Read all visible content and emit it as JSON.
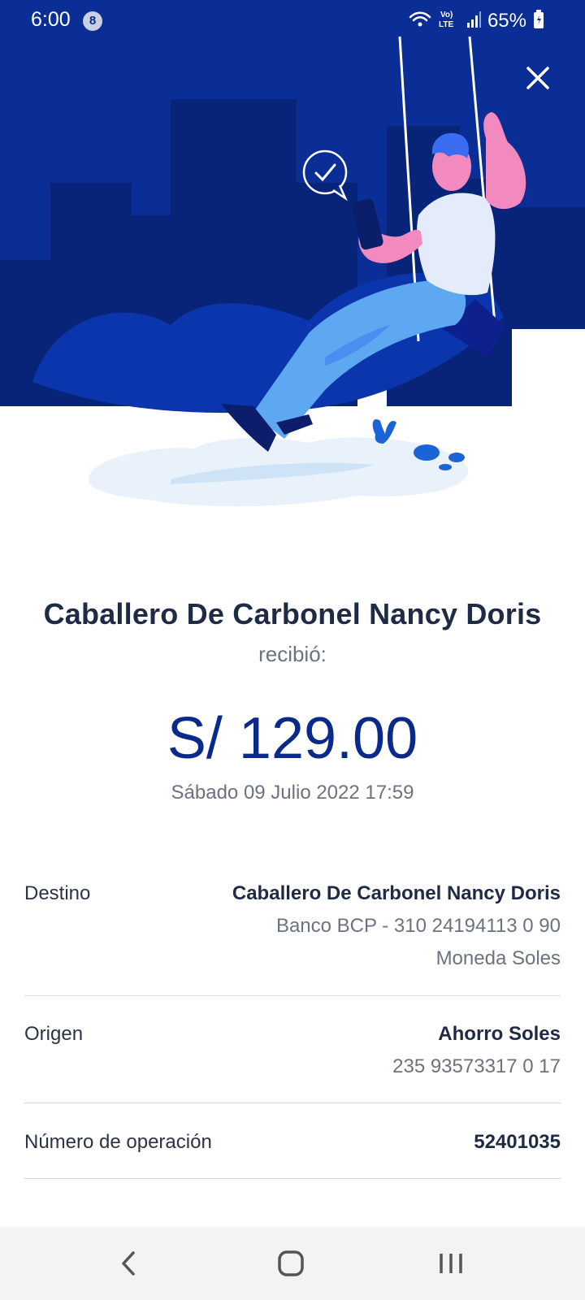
{
  "status_bar": {
    "time": "6:00",
    "notification_count": "8",
    "network": "LTE",
    "battery": "65%"
  },
  "receipt": {
    "recipient": "Caballero De Carbonel Nancy Doris",
    "received_label": "recibió:",
    "amount": "S/ 129.00",
    "date": "Sábado 09 Julio 2022 17:59"
  },
  "details": {
    "destino": {
      "label": "Destino",
      "name": "Caballero De Carbonel Nancy Doris",
      "bank": "Banco BCP - 310 24194113 0 90",
      "currency": "Moneda Soles"
    },
    "origen": {
      "label": "Origen",
      "account_type": "Ahorro Soles",
      "account_number": "235 93573317 0 17"
    },
    "operacion": {
      "label": "Número de operación",
      "number": "52401035"
    }
  },
  "icons": {
    "close": "close-icon",
    "back": "back-icon",
    "home": "home-icon",
    "recents": "recents-icon"
  },
  "colors": {
    "brand_dark": "#0a2a8a",
    "brand_deep": "#08237a",
    "amount_blue": "#0a2a8a"
  }
}
